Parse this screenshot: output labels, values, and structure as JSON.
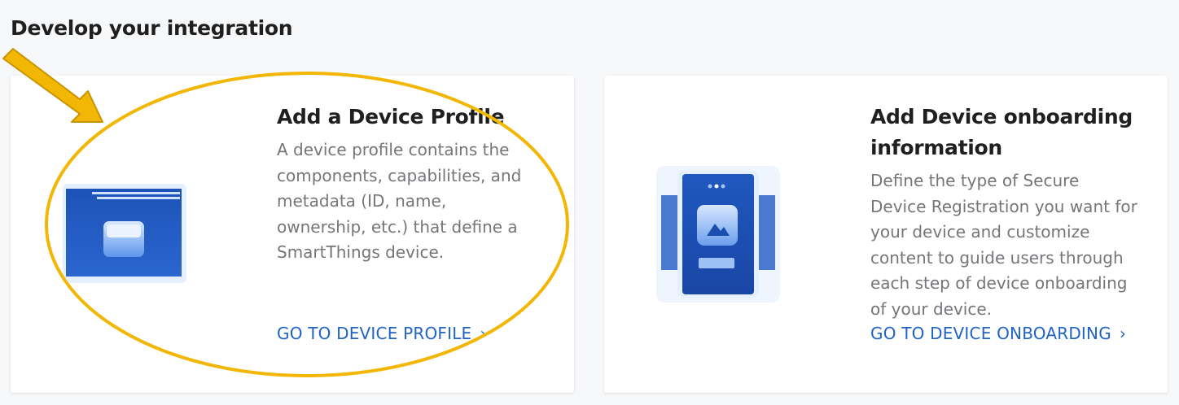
{
  "section": {
    "title": "Develop your integration"
  },
  "cards": [
    {
      "title": "Add a Device Profile",
      "description": "A device profile contains the components, capabilities, and metadata (ID, name, ownership, etc.) that define a SmartThings device.",
      "link_label": "GO TO DEVICE PROFILE",
      "illustration": "device-profile-illustration"
    },
    {
      "title": "Add Device onboarding information",
      "description": "Define the type of Secure Device Registration you want for your device and customize content to guide users through each step of device onboarding of your device.",
      "link_label": "GO TO DEVICE ONBOARDING",
      "illustration": "device-onboarding-illustration"
    }
  ],
  "icons": {
    "link_chevron": "chevron-right-icon"
  },
  "colors": {
    "accent_link": "#1f63c6",
    "annotation": "#f2b705",
    "illustration_blue": "#1a4fb0"
  }
}
